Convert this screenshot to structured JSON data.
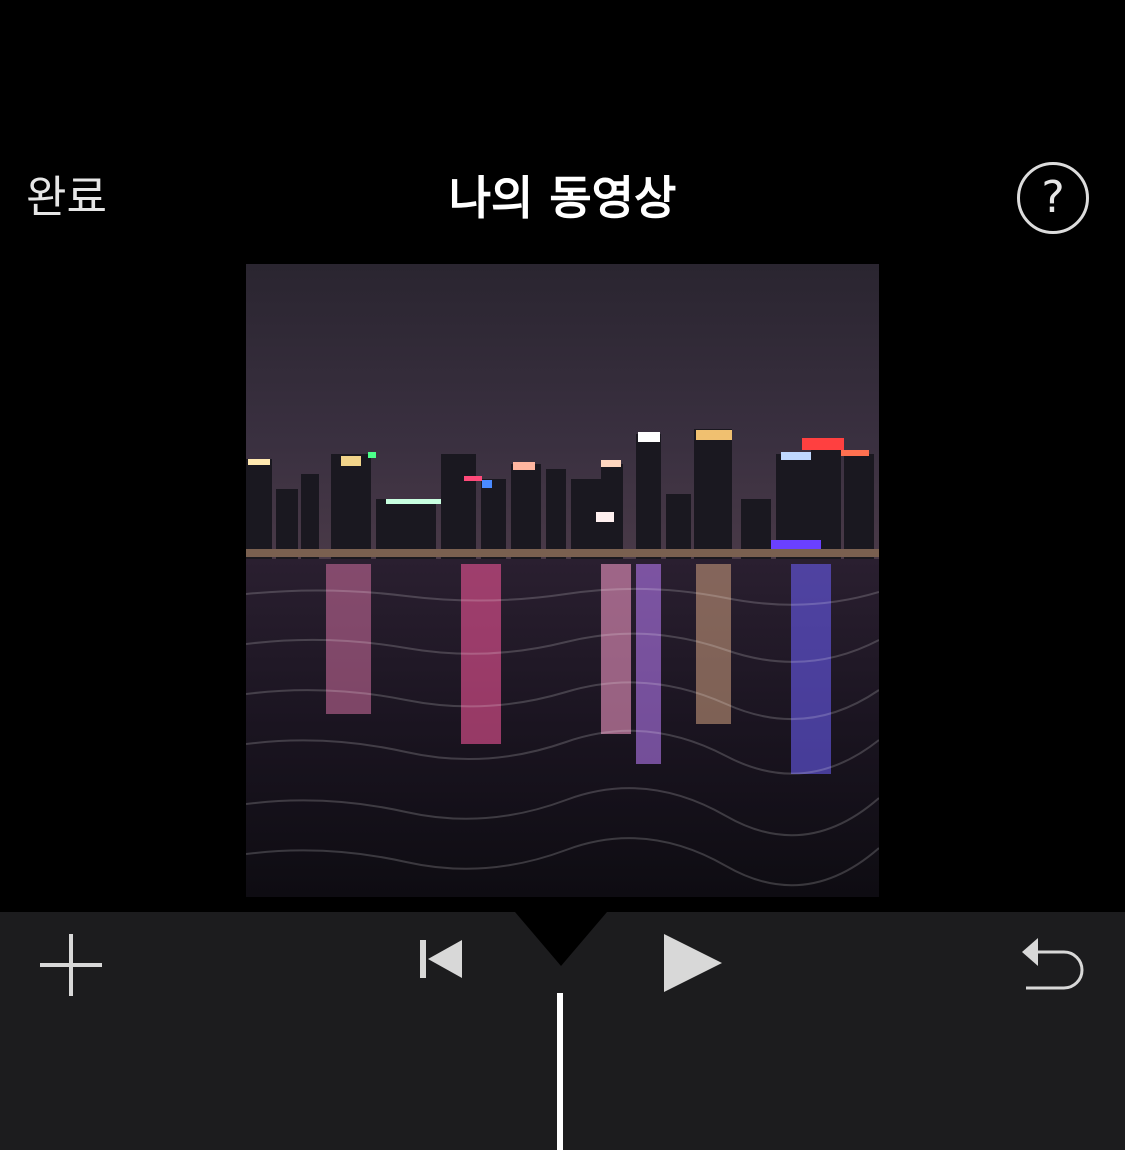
{
  "nav": {
    "done_label": "완료",
    "title": "나의 동영상",
    "help_label": "?"
  },
  "preview": {
    "icon": "video-preview-night-city-harbor"
  },
  "toolbar": {
    "add_icon": "plus-icon",
    "rewind_icon": "skip-to-start-icon",
    "play_icon": "play-icon",
    "undo_icon": "undo-icon"
  },
  "colors": {
    "background": "#000000",
    "toolbar": "#1c1c1e",
    "text": "#ffffff",
    "icon": "#d8d8d8"
  }
}
